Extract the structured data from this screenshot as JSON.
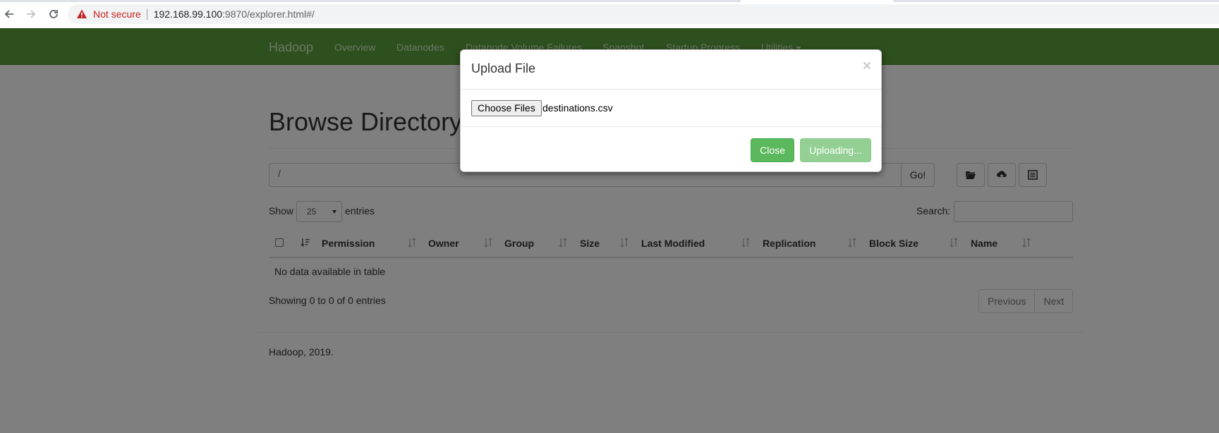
{
  "browser": {
    "security_label": "Not secure",
    "url_host": "192.168.99.100",
    "url_rest": ":9870/explorer.html#/"
  },
  "navbar": {
    "brand": "Hadoop",
    "links": [
      "Overview",
      "Datanodes",
      "Datanode Volume Failures",
      "Snapshot",
      "Startup Progress",
      "Utilities"
    ]
  },
  "main": {
    "title": "Browse Directory",
    "path_value": "/",
    "go_label": "Go!",
    "length_menu": {
      "show": "Show",
      "selected": "25",
      "entries": "entries"
    },
    "search_label": "Search:",
    "table": {
      "columns": [
        "Permission",
        "Owner",
        "Group",
        "Size",
        "Last Modified",
        "Replication",
        "Block Size",
        "Name"
      ],
      "empty_message": "No data available in table"
    },
    "info": "Showing 0 to 0 of 0 entries",
    "pagination": {
      "previous": "Previous",
      "next": "Next"
    },
    "footer": "Hadoop, 2019."
  },
  "modal": {
    "title": "Upload File",
    "close_x": "×",
    "choose_label": "Choose Files",
    "file_name": "destinations.csv",
    "close_button": "Close",
    "upload_button": "Uploading..."
  },
  "colors": {
    "navbar": "#5d9f3c",
    "button_success": "#5cb85c",
    "warning": "#c5221f"
  }
}
